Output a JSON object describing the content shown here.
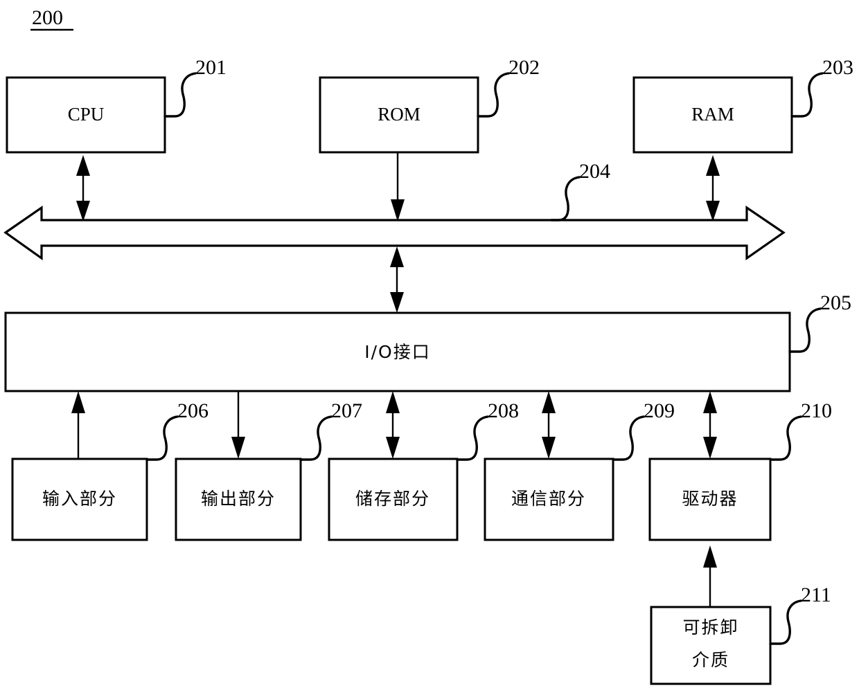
{
  "figure": {
    "number": "200",
    "underlined": true
  },
  "colors": {
    "stroke": "#000000",
    "fill": "#ffffff",
    "background": "#ffffff"
  },
  "blocks": [
    {
      "id": "cpu",
      "label": "CPU",
      "ref": "201",
      "script": "latin"
    },
    {
      "id": "rom",
      "label": "ROM",
      "ref": "202",
      "script": "latin"
    },
    {
      "id": "ram",
      "label": "RAM",
      "ref": "203",
      "script": "latin"
    },
    {
      "id": "bus",
      "label": "",
      "ref": "204",
      "script": "none"
    },
    {
      "id": "io",
      "label": "I/O接口",
      "ref": "205",
      "script": "mixed"
    },
    {
      "id": "input",
      "label": "输入部分",
      "ref": "206",
      "script": "cjk"
    },
    {
      "id": "output",
      "label": "输出部分",
      "ref": "207",
      "script": "cjk"
    },
    {
      "id": "storage",
      "label": "储存部分",
      "ref": "208",
      "script": "cjk"
    },
    {
      "id": "comm",
      "label": "通信部分",
      "ref": "209",
      "script": "cjk"
    },
    {
      "id": "drive",
      "label": "驱动器",
      "ref": "210",
      "script": "cjk"
    },
    {
      "id": "media",
      "label_line1": "可拆卸",
      "label_line2": "介质",
      "ref": "211",
      "script": "cjk"
    }
  ],
  "connections": [
    {
      "from": "cpu",
      "to": "bus",
      "type": "bidirectional"
    },
    {
      "from": "rom",
      "to": "bus",
      "type": "down"
    },
    {
      "from": "ram",
      "to": "bus",
      "type": "bidirectional"
    },
    {
      "from": "bus",
      "to": "io",
      "type": "bidirectional"
    },
    {
      "from": "input",
      "to": "io",
      "type": "up"
    },
    {
      "from": "io",
      "to": "output",
      "type": "down"
    },
    {
      "from": "storage",
      "to": "io",
      "type": "bidirectional"
    },
    {
      "from": "comm",
      "to": "io",
      "type": "bidirectional"
    },
    {
      "from": "drive",
      "to": "io",
      "type": "bidirectional"
    },
    {
      "from": "media",
      "to": "drive",
      "type": "up"
    }
  ]
}
